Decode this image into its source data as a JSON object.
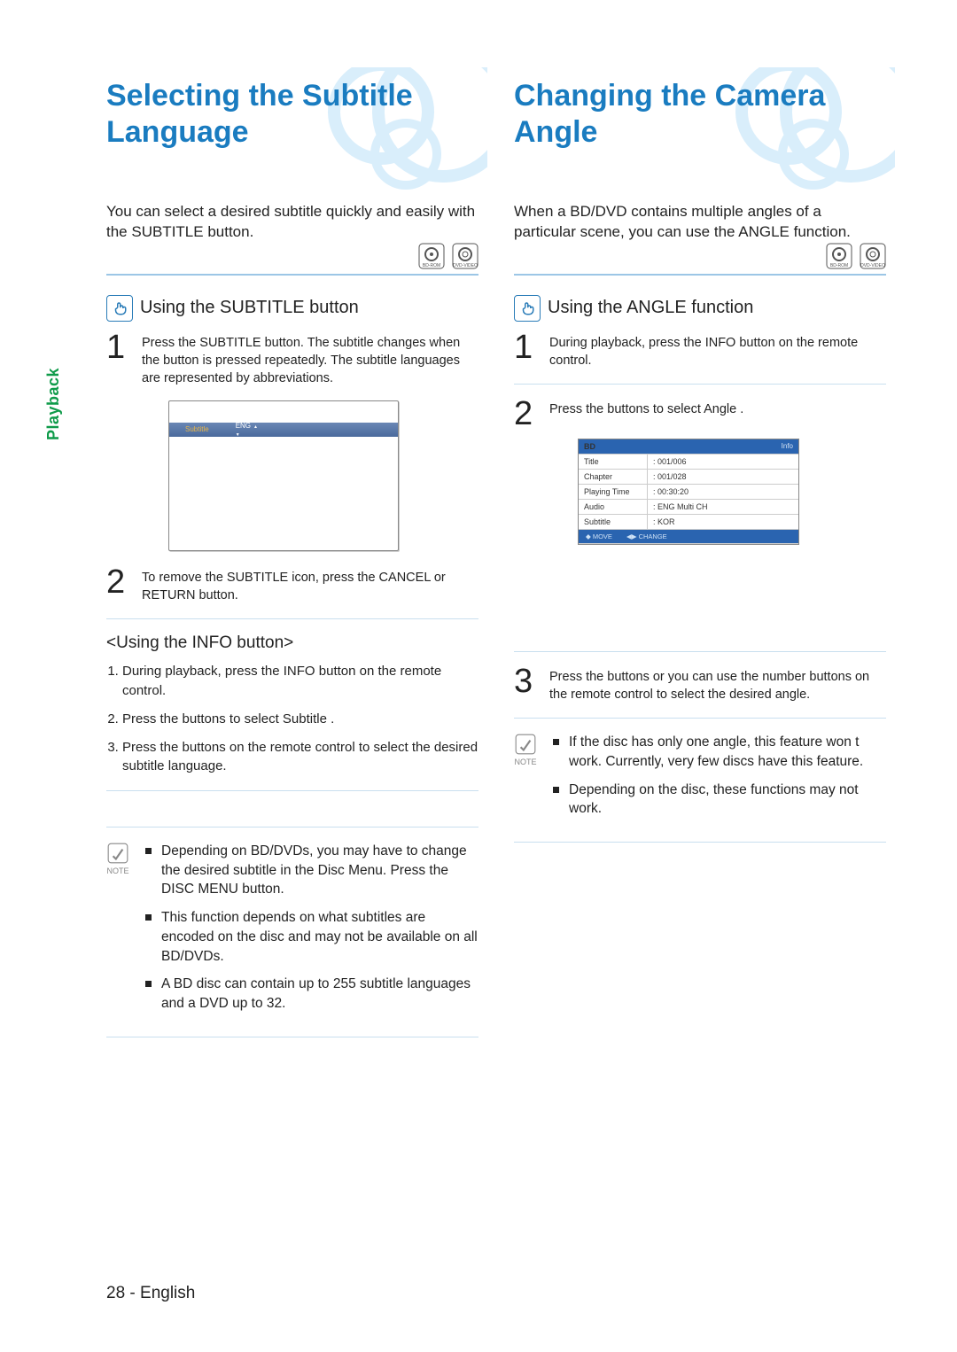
{
  "side_tab": "Playback",
  "left": {
    "title": "Selecting the Subtitle Language",
    "intro": "You can select a desired subtitle quickly and easily with the SUBTITLE button.",
    "disc_icons": [
      "BD-ROM",
      "DVD-VIDEO"
    ],
    "subhead": "Using the SUBTITLE button",
    "step1": "Press the SUBTITLE button. The subtitle changes when the button is pressed repeatedly. The subtitle languages are represented by abbreviations.",
    "illus_label": "Subtitle",
    "illus_value": "ENG",
    "step2": "To remove the SUBTITLE icon, press the CANCEL or RETURN button.",
    "info_heading": "<Using the INFO button>",
    "info_steps": [
      "During playback, press the INFO button on the remote control.",
      "Press the         buttons to select Subtitle .",
      "Press the         buttons on the remote control to select the desired subtitle language."
    ],
    "notes": [
      "Depending on BD/DVDs, you may have to change the desired subtitle in the Disc Menu. Press the DISC MENU button.",
      "This function depends on what subtitles are encoded on the disc and may not be available on all BD/DVDs.",
      "A BD disc can contain up to 255 subtitle languages and a DVD up to 32."
    ]
  },
  "right": {
    "title": "Changing the Camera Angle",
    "intro": "When a BD/DVD contains multiple angles of a particular scene, you can use the ANGLE function.",
    "disc_icons": [
      "BD-ROM",
      "DVD-VIDEO"
    ],
    "subhead": "Using the ANGLE function",
    "step1": "During playback, press the INFO button on the remote control.",
    "step2_pre": "Press the ",
    "step2_post": "        buttons to select Angle .",
    "info_panel": {
      "header_label": "BD",
      "header_right": "Info",
      "rows": [
        {
          "label": "Title",
          "value": ": 001/006"
        },
        {
          "label": "Chapter",
          "value": ": 001/028"
        },
        {
          "label": "Playing Time",
          "value": ": 00:30:20"
        },
        {
          "label": "Audio",
          "value": ": ENG Multi CH"
        },
        {
          "label": "Subtitle",
          "value": ": KOR"
        }
      ],
      "footer_left": "◆  MOVE",
      "footer_right": "◀▶ CHANGE"
    },
    "step3": "Press the         buttons or you can use the number buttons on the remote control to select the desired angle.",
    "notes": [
      "If the disc has only one angle, this feature won t work. Currently, very few discs have this feature.",
      "Depending on the disc, these functions may not work."
    ]
  },
  "page_num": "28",
  "page_lang": "English",
  "note_label": "NOTE"
}
